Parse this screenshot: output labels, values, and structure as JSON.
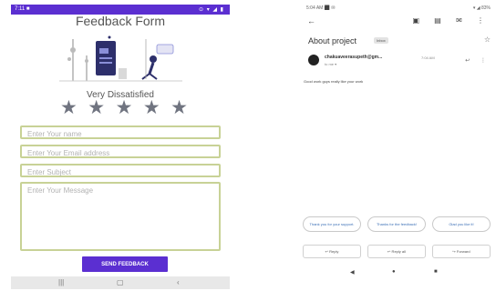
{
  "left_phone": {
    "status_time": "7:11 ■",
    "status_icons": "⊙ ▾ ◢ ▮",
    "title": "Feedback Form",
    "rating_label": "Very Dissatisfied",
    "stars": [
      "★",
      "★",
      "★",
      "★",
      "★"
    ],
    "fields": {
      "name_placeholder": "Enter Your name",
      "email_placeholder": "Enter Your Email address",
      "subject_placeholder": "Enter Subject",
      "message_placeholder": "Enter Your Message"
    },
    "send_label": "SEND FEEDBACK",
    "nav": {
      "recents": "|||",
      "home": "▢",
      "back": "‹"
    },
    "colors": {
      "accent": "#5b2fd1",
      "field_border": "#c8d296",
      "star": "#707480"
    }
  },
  "right_phone": {
    "status_time": "5:04 AM ⬛ ✉",
    "status_right": "▾ ◢ 83%",
    "back": "←",
    "toolbar": "▣ ▤ ✉ ⋮",
    "subject": "About project",
    "inbox_badge": "Inbox",
    "star": "☆",
    "sender": "chakuaveerasupeth@gm...",
    "date": "7:04 AM",
    "to": "to me ▾",
    "sender_icons": "↩ ⋮",
    "body": "Good work guys really like your work",
    "smart_replies": [
      "Thank you for your support.",
      "Thanks for the feedback!",
      "Glad you like it!"
    ],
    "actions": {
      "reply": "↩ Reply",
      "reply_all": "↩ Reply all",
      "forward": "↪ Forward"
    },
    "nav": {
      "back": "◀",
      "home": "●",
      "recents": "■"
    }
  }
}
